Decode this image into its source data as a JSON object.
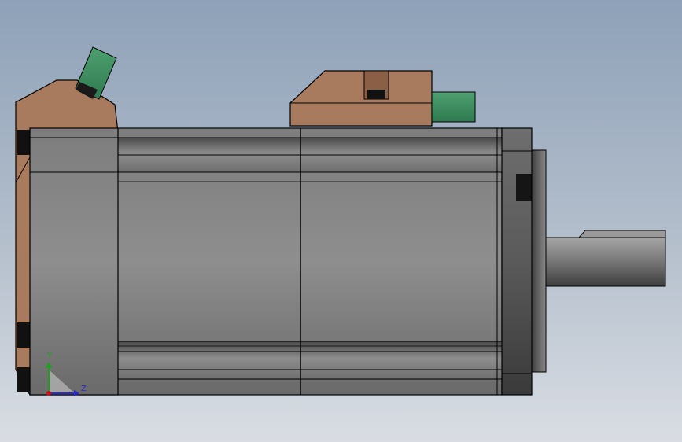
{
  "viewport": {
    "background_top": "#8ea1b8",
    "background_bottom": "#d9dde3"
  },
  "model": {
    "body_color": "#8c8c8c",
    "housing_color": "#a97b5e",
    "connector_color": "#3f8a5f",
    "outline_color": "#000000"
  },
  "triad": {
    "y_label": "Y",
    "z_label": "Z",
    "y_color": "#1aa31a",
    "z_color": "#2a2ac8",
    "x_color": "#d01010"
  }
}
